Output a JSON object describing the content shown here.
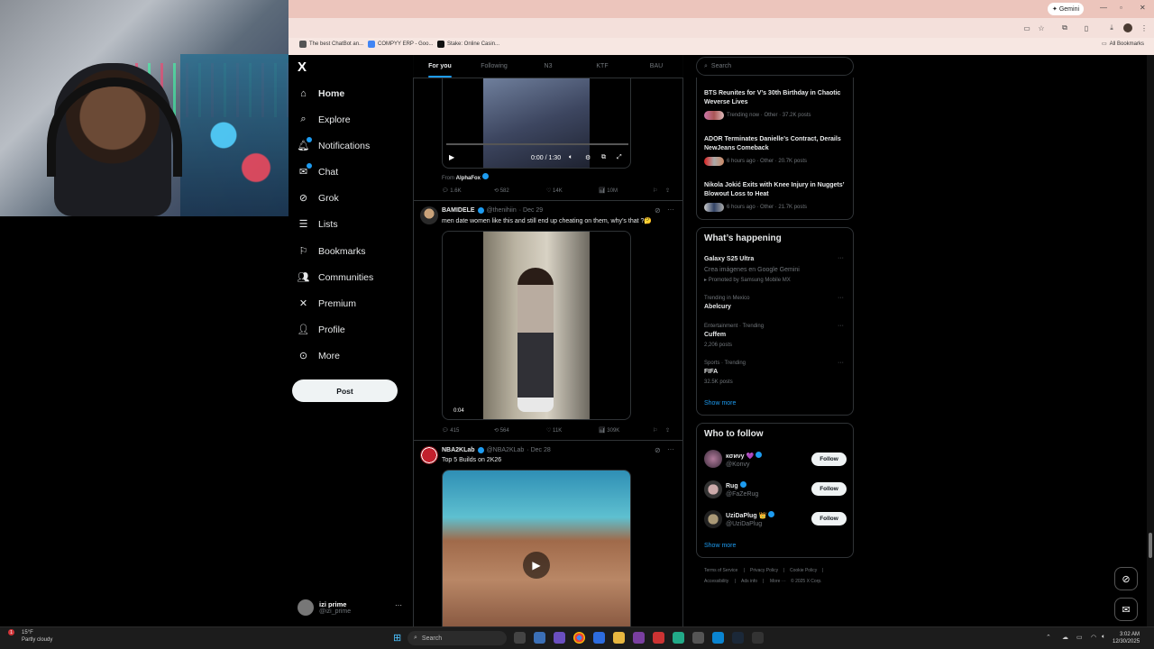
{
  "browser": {
    "gemini_label": "Gemini",
    "bookmarks": [
      "The best ChatBot an...",
      "COMPYY ERP - Goo...",
      "Stake: Online Casin..."
    ],
    "all_bookmarks": "All Bookmarks"
  },
  "nav": {
    "logo": "X",
    "items": [
      {
        "label": "Home",
        "icon": "home-icon"
      },
      {
        "label": "Explore",
        "icon": "search-icon"
      },
      {
        "label": "Notifications",
        "icon": "bell-icon"
      },
      {
        "label": "Chat",
        "icon": "mail-icon"
      },
      {
        "label": "Grok",
        "icon": "grok-icon"
      },
      {
        "label": "Lists",
        "icon": "list-icon"
      },
      {
        "label": "Bookmarks",
        "icon": "bookmark-icon"
      },
      {
        "label": "Communities",
        "icon": "people-icon"
      },
      {
        "label": "Premium",
        "icon": "x-icon"
      },
      {
        "label": "Profile",
        "icon": "user-icon"
      },
      {
        "label": "More",
        "icon": "more-circle-icon"
      }
    ],
    "post_button": "Post",
    "account": {
      "name": "izi prime",
      "handle": "@izi_prime"
    }
  },
  "tabs": [
    "For you",
    "Following",
    "N3",
    "KTF",
    "BAU"
  ],
  "timeline": {
    "tweet1": {
      "video_time": "0:00 / 1:30",
      "from_label": "From",
      "from_name": "AlphaFox",
      "stats": [
        "1.6K",
        "582",
        "14K",
        "10M"
      ]
    },
    "tweet2": {
      "name": "BAMIDELE",
      "handle": "@thenihiin",
      "date": "· Dec 29",
      "text": "men date women like this and still end up cheating on them, why’s that ?🤔",
      "video_time": "0:04",
      "stats": [
        "415",
        "564",
        "11K",
        "309K"
      ]
    },
    "tweet3": {
      "name": "NBA2KLab",
      "handle": "@NBA2KLab",
      "date": "· Dec 28",
      "text": "Top 5 Builds on 2K26"
    }
  },
  "right": {
    "search_placeholder": "Search",
    "news": [
      {
        "title": "BTS Reunites for V’s 30th Birthday in Chaotic Weverse Lives",
        "meta": "Trending now · Other · 37.2K posts"
      },
      {
        "title": "ADOR Terminates Danielle’s Contract, Derails NewJeans Comeback",
        "meta": "6 hours ago · Other · 20.7K posts"
      },
      {
        "title": "Nikola Jokić Exits with Knee Injury in Nuggets’ Blowout Loss to Heat",
        "meta": "6 hours ago · Other · 21.7K posts"
      }
    ],
    "happening_title": "What’s happening",
    "trends": [
      {
        "name": "Galaxy S25 Ultra",
        "sub": "Crea imágenes en Google Gemini",
        "promo": "Promoted by Samsung Mobile MX"
      },
      {
        "category": "Trending in Mexico",
        "name": "Abelcury"
      },
      {
        "category": "Entertainment · Trending",
        "name": "Cuffem",
        "posts": "2,206 posts"
      },
      {
        "category": "Sports · Trending",
        "name": "FIFA",
        "posts": "32.5K posts"
      }
    ],
    "show_more": "Show more",
    "wtf_title": "Who to follow",
    "wtf": [
      {
        "name": "κσиνу 💜",
        "handle": "@Konvy"
      },
      {
        "name": "Rug",
        "handle": "@FaZeRug"
      },
      {
        "name": "UziDaPlug 👑",
        "handle": "@UziDaPlug"
      }
    ],
    "follow_label": "Follow",
    "wtf_show_more": "Show more",
    "footer": [
      "Terms of Service",
      "|",
      "Privacy Policy",
      "|",
      "Cookie Policy",
      "|",
      "Accessibility",
      "|",
      "Ads info",
      "|",
      "More ···",
      "© 2025 X Corp."
    ]
  },
  "taskbar": {
    "weather_temp": "15°F",
    "weather_desc": "Partly cloudy",
    "weather_badge": "1",
    "search": "Search",
    "time": "3:02 AM",
    "date": "12/30/2025"
  }
}
